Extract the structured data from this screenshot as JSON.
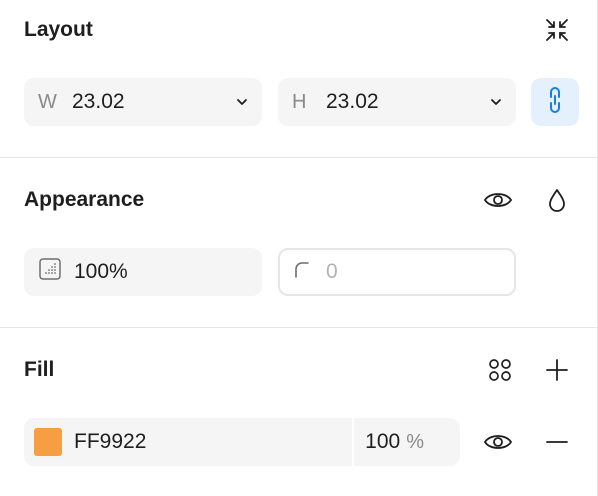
{
  "layout": {
    "title": "Layout",
    "width": {
      "prefix": "W",
      "value": "23.02"
    },
    "height": {
      "prefix": "H",
      "value": "23.02"
    },
    "icons": {
      "collapse": "collapse-arrows-icon",
      "chevron": "chevron-down-icon",
      "link": "link-icon"
    }
  },
  "appearance": {
    "title": "Appearance",
    "opacity": {
      "value": "100%"
    },
    "corner_radius": {
      "value": "0"
    },
    "icons": {
      "visibility": "eye-icon",
      "blend": "drop-icon",
      "opacity": "opacity-grid-icon",
      "radius": "corner-radius-icon"
    }
  },
  "fill": {
    "title": "Fill",
    "item": {
      "color": "#F59E42",
      "hex": "FF9922",
      "opacity": "100",
      "unit": "%"
    },
    "icons": {
      "styles": "styles-grid-icon",
      "add": "plus-icon",
      "visibility": "eye-icon",
      "remove": "minus-icon"
    }
  }
}
